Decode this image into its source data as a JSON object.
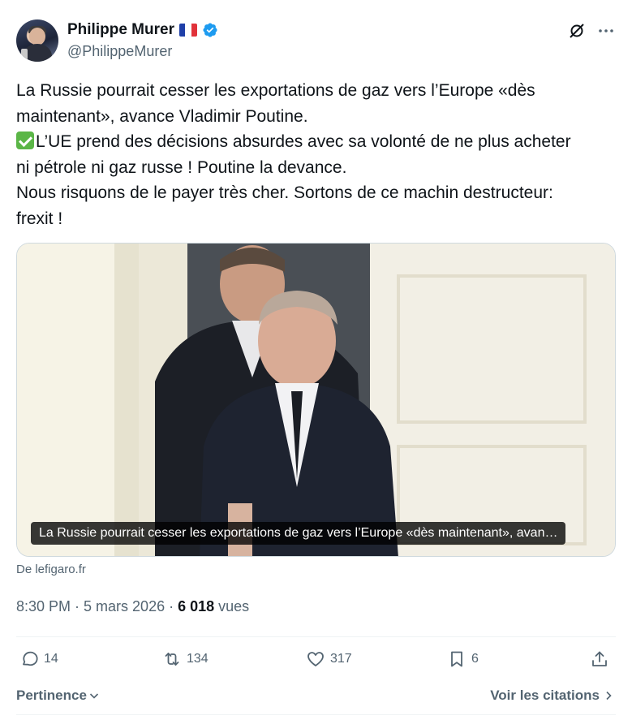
{
  "author": {
    "name": "Philippe Murer",
    "handle": "@PhilippeMurer",
    "flag": "french-flag-icon",
    "verified_icon": "verified-badge-icon"
  },
  "tweet": {
    "line1": "La Russie pourrait cesser les exportations de gaz vers l’Europe «dès",
    "line2": "maintenant», avance Vladimir Poutine.",
    "line3": "L’UE prend des décisions absurdes avec sa volonté de ne plus acheter",
    "line4": "ni pétrole ni gaz russe ! Poutine la devance.",
    "line5": "Nous risquons de le payer très cher. Sortons de ce machin destructeur:",
    "line6": "frexit !"
  },
  "card": {
    "caption": "La Russie pourrait cesser les exportations de gaz vers l’Europe «dès maintenant», avan…",
    "source": "De lefigaro.fr"
  },
  "meta": {
    "time_date": "8:30 PM · 5 mars 2026 · ",
    "views_count": "6 018",
    "views_label": " vues"
  },
  "actions": {
    "replies": "14",
    "reposts": "134",
    "likes": "317",
    "bookmarks": "6"
  },
  "footer": {
    "sort_label": "Pertinence",
    "quotes_label": "Voir les citations"
  },
  "colors": {
    "accent": "#1d9bf0",
    "text_primary": "#0f1419",
    "text_secondary": "#536471",
    "divider": "#eff3f4",
    "check_green": "#5bb647"
  }
}
